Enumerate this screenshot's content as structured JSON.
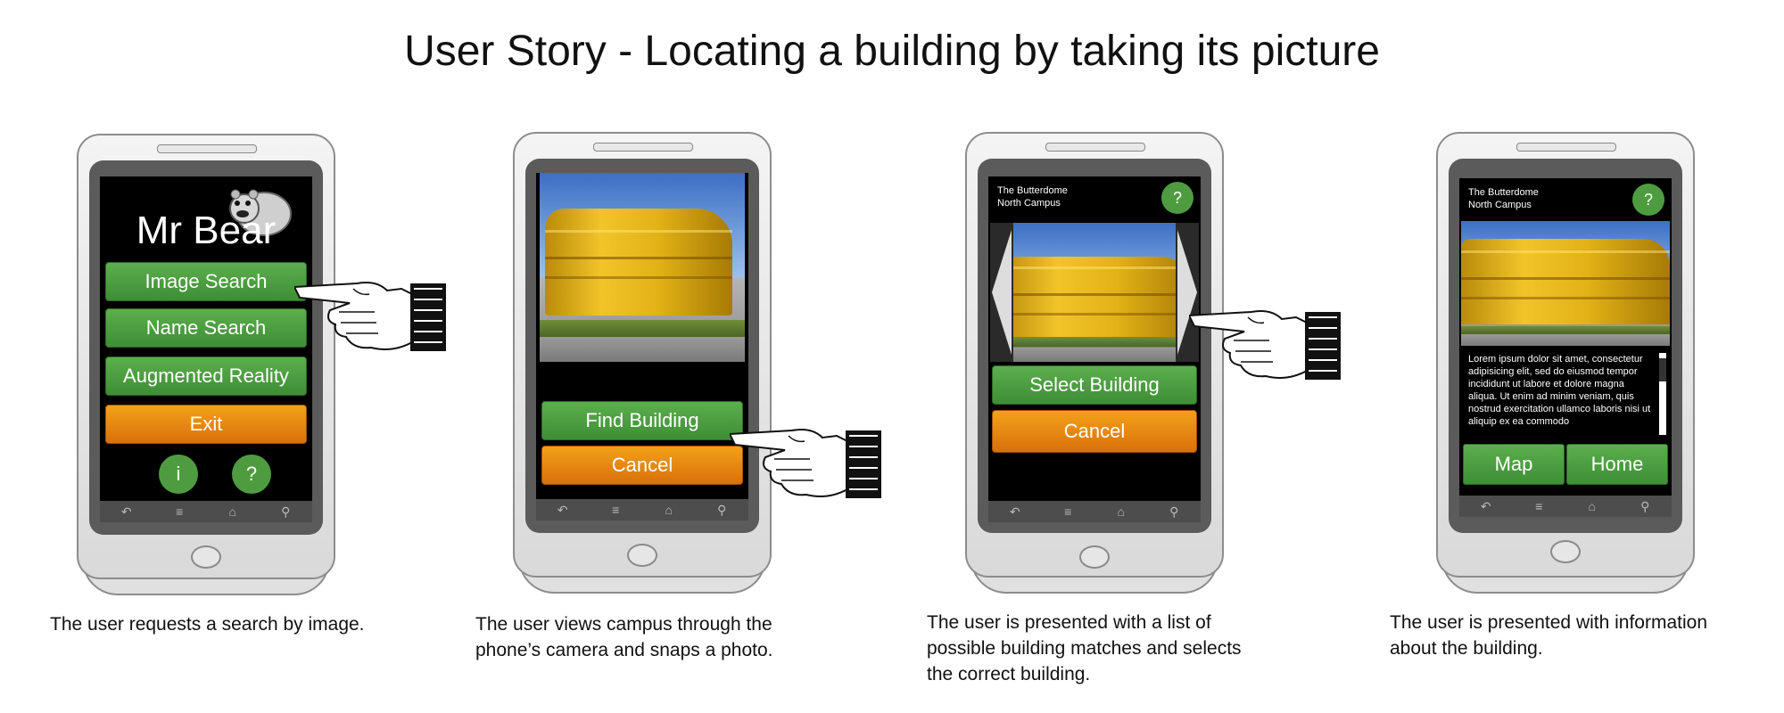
{
  "title": "User Story - Locating a building by taking its picture",
  "phone1": {
    "app_title": "Mr Bear",
    "buttons": [
      "Image Search",
      "Name Search",
      "Augmented Reality",
      "Exit"
    ],
    "info_label": "i",
    "help_label": "?"
  },
  "phone2": {
    "find_label": "Find Building",
    "cancel_label": "Cancel"
  },
  "phone3": {
    "header_line1": "The Butterdome",
    "header_line2": "North Campus",
    "help_label": "?",
    "select_label": "Select Building",
    "cancel_label": "Cancel"
  },
  "phone4": {
    "header_line1": "The Butterdome",
    "header_line2": "North Campus",
    "help_label": "?",
    "body_text": "Lorem ipsum dolor sit amet, consectetur adipisicing elit, sed do eiusmod tempor incididunt ut labore et dolore magna aliqua. Ut enim ad minim veniam, quis nostrud exercitation ullamco laboris nisi ut aliquip ex ea commodo",
    "map_label": "Map",
    "home_label": "Home"
  },
  "captions": {
    "c1": "The user requests a search by image.",
    "c2a": "The user views campus through the",
    "c2b": "phone’s camera and snaps a photo.",
    "c3a": "The user is presented with a list of",
    "c3b": "possible building matches and selects",
    "c3c": "the correct building.",
    "c4a": "The user is presented with information",
    "c4b": "about the building."
  },
  "icons": [
    "back-icon",
    "menu-icon",
    "home-icon",
    "search-icon",
    "pointing-hand-icon",
    "bear-icon"
  ],
  "colors": {
    "green": "#4e9c3f",
    "orange": "#e8870f",
    "screen_bg": "#000000"
  }
}
